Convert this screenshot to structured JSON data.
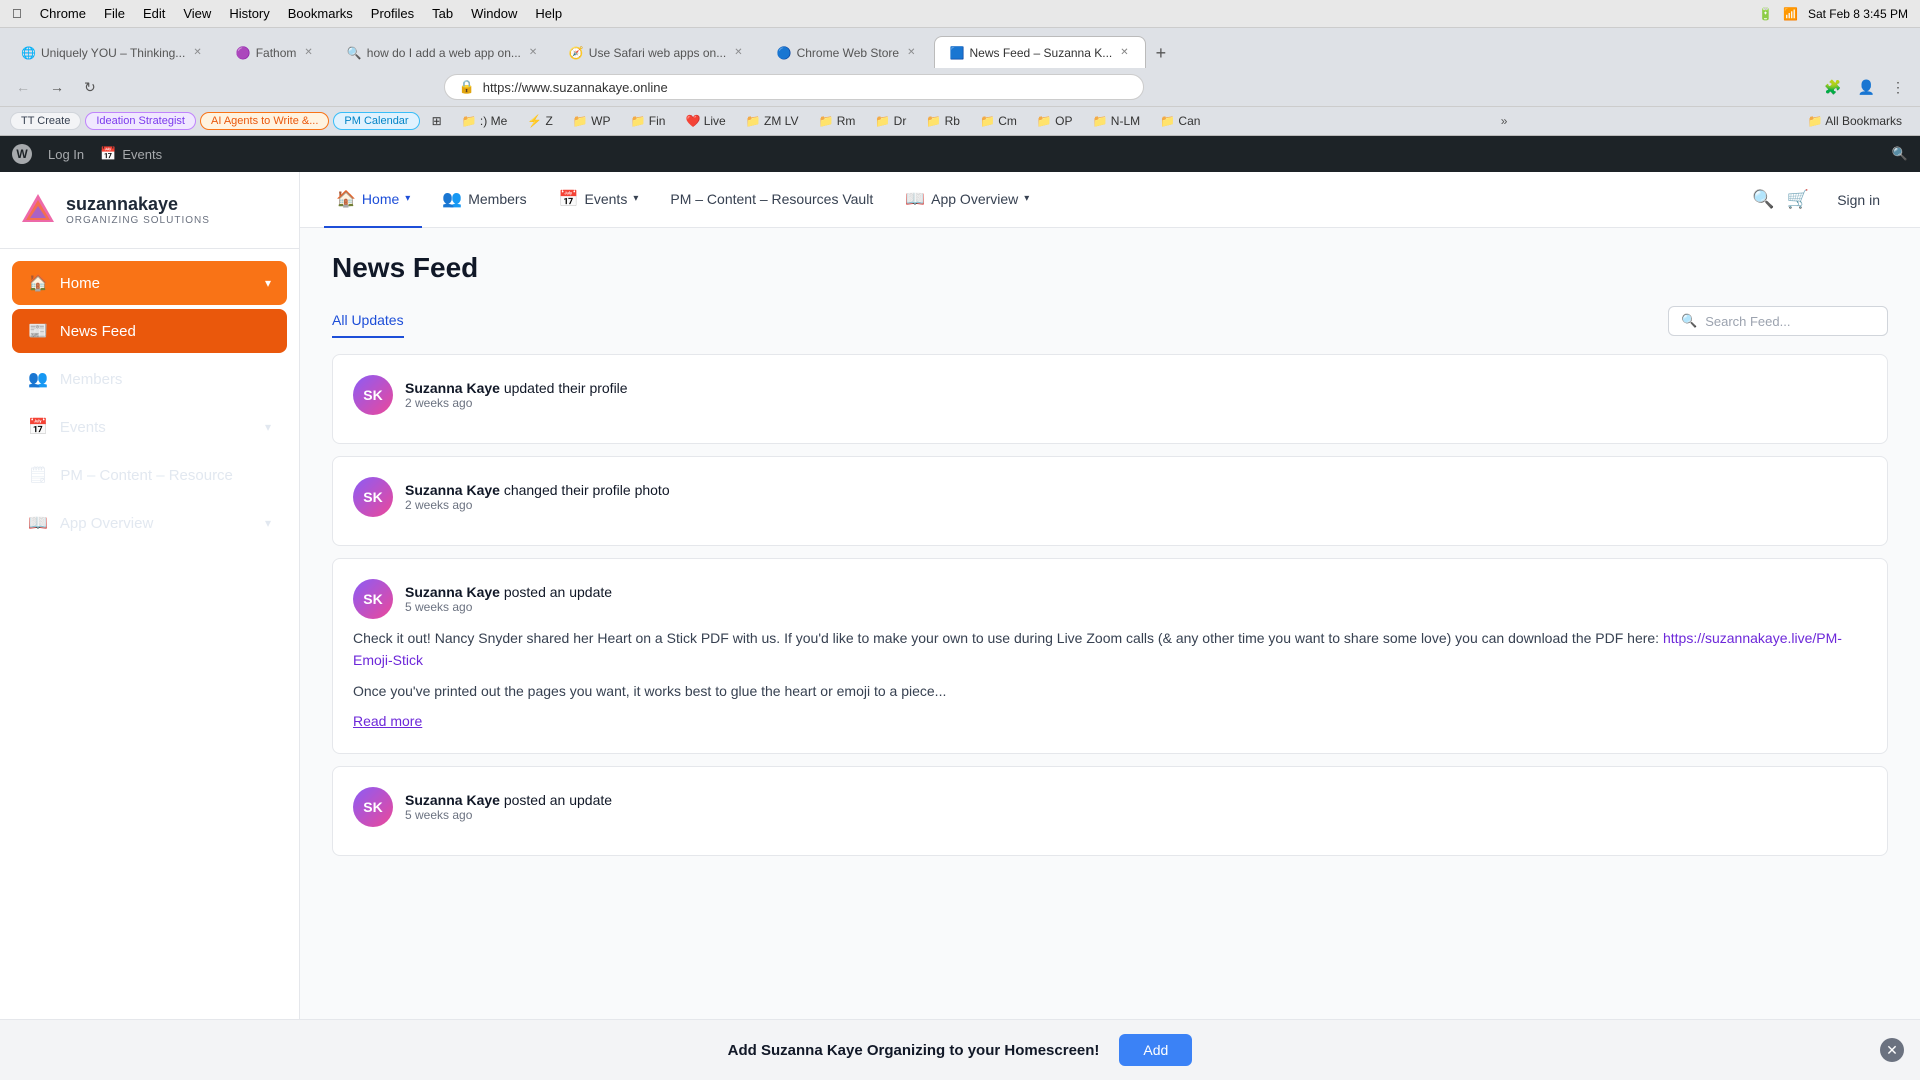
{
  "macBar": {
    "appName": "Chrome",
    "menus": [
      "Chrome",
      "File",
      "Edit",
      "View",
      "History",
      "Bookmarks",
      "Profiles",
      "Tab",
      "Window",
      "Help"
    ],
    "time": "Sat Feb 8  3:45 PM",
    "battery": "100%"
  },
  "browser": {
    "tabs": [
      {
        "id": "uniquely",
        "favicon": "🌐",
        "title": "Uniquely YOU – Thinking...",
        "active": false
      },
      {
        "id": "fathom",
        "favicon": "🟣",
        "title": "Fathom",
        "active": false
      },
      {
        "id": "howdo",
        "favicon": "🔍",
        "title": "how do I add a web app on...",
        "active": false
      },
      {
        "id": "safari",
        "favicon": "🧭",
        "title": "Use Safari web apps on...",
        "active": false
      },
      {
        "id": "chrome",
        "favicon": "🔵",
        "title": "Chrome Web Store",
        "active": false
      },
      {
        "id": "newsfeed",
        "favicon": "🟦",
        "title": "News Feed – Suzanna K...",
        "active": true
      }
    ],
    "addressBarUrl": "https://www.suzannakaye.online",
    "bookmarks": [
      {
        "type": "pill",
        "label": "TT Create",
        "style": "default"
      },
      {
        "type": "pill",
        "label": "Ideation Strategist",
        "style": "purple"
      },
      {
        "type": "pill",
        "label": "AI Agents to Write &...",
        "style": "orange"
      },
      {
        "type": "pill",
        "label": "PM Calendar",
        "style": "blue"
      },
      {
        "type": "icon",
        "label": "⊞"
      },
      {
        "type": "folder",
        "icon": "📁",
        "label": ":) Me"
      },
      {
        "type": "folder",
        "icon": "⚡",
        "label": "Z"
      },
      {
        "type": "folder",
        "icon": "📁",
        "label": "WP"
      },
      {
        "type": "folder",
        "icon": "📁",
        "label": "Fin"
      },
      {
        "type": "folder",
        "icon": "❤️",
        "label": "Live"
      },
      {
        "type": "folder",
        "icon": "📁",
        "label": "ZM LV"
      },
      {
        "type": "folder",
        "icon": "📁",
        "label": "Rm"
      },
      {
        "type": "folder",
        "icon": "📁",
        "label": "Dr"
      },
      {
        "type": "folder",
        "icon": "📁",
        "label": "Rb"
      },
      {
        "type": "folder",
        "icon": "📁",
        "label": "Cm"
      },
      {
        "type": "folder",
        "icon": "📁",
        "label": "OP"
      },
      {
        "type": "folder",
        "icon": "📁",
        "label": "N-LM"
      },
      {
        "type": "folder",
        "icon": "📁",
        "label": "Can"
      },
      {
        "type": "more",
        "label": "»"
      },
      {
        "type": "folder",
        "icon": "📁",
        "label": "All Bookmarks"
      }
    ]
  },
  "wpAdminBar": {
    "wordpressIcon": "W",
    "loginLabel": "Log In",
    "eventsLabel": "Events"
  },
  "sidebar": {
    "logoText": "suzannakaye",
    "logoTagline": "ORGANIZING SOLUTIONS",
    "navItems": [
      {
        "id": "home",
        "icon": "🏠",
        "label": "Home",
        "active": true,
        "hasChevron": true
      },
      {
        "id": "news-feed",
        "icon": "📰",
        "label": "News Feed",
        "active": true,
        "isNewsFeed": true
      },
      {
        "id": "members",
        "icon": "👥",
        "label": "Members",
        "active": false
      },
      {
        "id": "events",
        "icon": "📅",
        "label": "Events",
        "active": false,
        "hasChevron": true
      },
      {
        "id": "pm-content",
        "icon": "🗒",
        "label": "PM – Content – Resource",
        "active": false
      },
      {
        "id": "app-overview",
        "icon": "📖",
        "label": "App Overview",
        "active": false,
        "hasChevron": true
      }
    ]
  },
  "topNav": {
    "items": [
      {
        "id": "home",
        "icon": "🏠",
        "label": "Home",
        "hasChevron": true,
        "active": true
      },
      {
        "id": "members",
        "icon": "👥",
        "label": "Members",
        "active": false
      },
      {
        "id": "events",
        "icon": "📅",
        "label": "Events",
        "hasChevron": true,
        "active": false
      },
      {
        "id": "pm-content",
        "label": "PM – Content – Resources Vault",
        "active": false
      },
      {
        "id": "app-overview",
        "icon": "📖",
        "label": "App Overview",
        "hasChevron": true,
        "active": false
      }
    ],
    "signInLabel": "Sign in"
  },
  "page": {
    "title": "News Feed",
    "tabs": [
      {
        "id": "all-updates",
        "label": "All Updates",
        "active": true
      }
    ],
    "searchPlaceholder": "Search Feed...",
    "feedItems": [
      {
        "id": "feed-1",
        "author": "Suzanna Kaye",
        "action": "updated their profile",
        "time": "2 weeks ago",
        "hasContent": false
      },
      {
        "id": "feed-2",
        "author": "Suzanna Kaye",
        "action": "changed their profile photo",
        "time": "2 weeks ago",
        "hasContent": false
      },
      {
        "id": "feed-3",
        "author": "Suzanna Kaye",
        "action": "posted an update",
        "time": "5 weeks ago",
        "hasContent": true,
        "content": "Check it out! Nancy Snyder shared her Heart on a Stick PDF with us. If you'd like to make your own to use during Live Zoom calls (& any other time you want to share some love) you can download the PDF here: https://suzannakaye.live/PM-Emoji-Stick",
        "contentLink": "https://suzannakaye.live/PM-Emoji-Stick",
        "contentContinued": "Once you've printed out the pages you want, it works best to glue the heart or emoji to a piece...",
        "hasReadMore": true,
        "readMoreLabel": "Read more"
      },
      {
        "id": "feed-4",
        "author": "Suzanna Kaye",
        "action": "posted an update",
        "time": "5 weeks ago",
        "hasContent": false
      }
    ]
  },
  "banner": {
    "text": "Add Suzanna Kaye Organizing to your Homescreen!",
    "addLabel": "Add"
  }
}
